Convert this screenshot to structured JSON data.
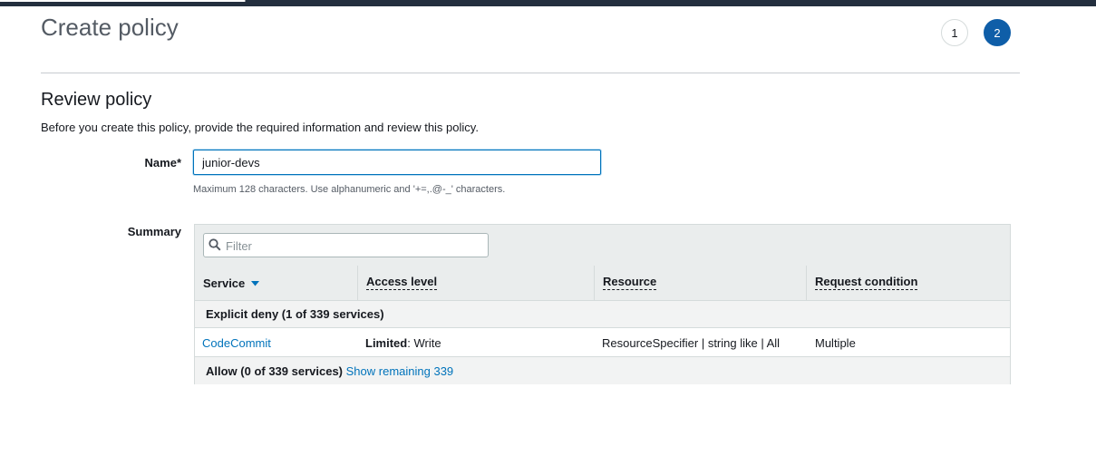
{
  "header": {
    "title": "Create policy",
    "steps": [
      "1",
      "2"
    ],
    "active_step": "2"
  },
  "review": {
    "title": "Review policy",
    "description": "Before you create this policy, provide the required information and review this policy."
  },
  "name_field": {
    "label": "Name*",
    "value": "junior-devs",
    "hint": "Maximum 128 characters. Use alphanumeric and '+=,.@-_' characters."
  },
  "summary": {
    "label": "Summary",
    "filter_placeholder": "Filter",
    "columns": {
      "service": "Service",
      "access": "Access level",
      "resource": "Resource",
      "condition": "Request condition"
    },
    "deny_group": "Explicit deny (1 of 339 services)",
    "rows": [
      {
        "service": "CodeCommit",
        "access_bold": "Limited",
        "access_rest": ": Write",
        "resource": "ResourceSpecifier | string like | All",
        "condition": "Multiple"
      }
    ],
    "allow_group": "Allow (0 of 339 services)",
    "show_remaining": "Show remaining 339"
  },
  "colors": {
    "topbar": "#232f3e",
    "accent": "#0073bb",
    "active_step": "#0f5ea8"
  }
}
